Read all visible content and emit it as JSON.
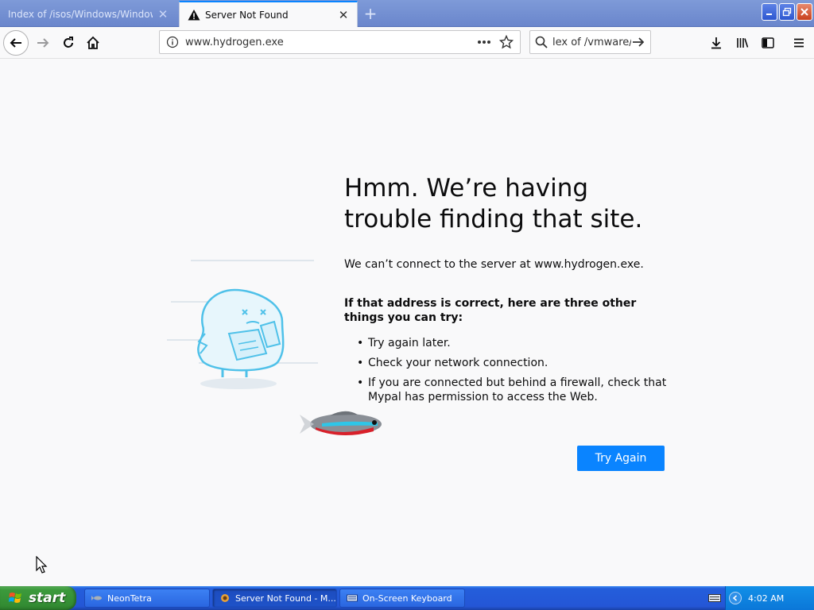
{
  "tabs": [
    {
      "label": "Index of /isos/Windows/Windows_Vist",
      "active": false
    },
    {
      "label": "Server Not Found",
      "active": true
    }
  ],
  "navbar": {
    "url": "www.hydrogen.exe",
    "search_value": "lex of /vmware/"
  },
  "page": {
    "title": "Hmm. We’re having trouble finding that site.",
    "message": "We can’t connect to the server at www.hydrogen.exe.",
    "suggestions_heading": "If that address is correct, here are three other things you can try:",
    "suggestions": [
      "Try again later.",
      "Check your network connection.",
      "If you are connected but behind a firewall, check that Mypal has permission to access the Web."
    ],
    "try_again_label": "Try Again"
  },
  "taskbar": {
    "start_label": "start",
    "tasks": [
      {
        "label": "NeonTetra"
      },
      {
        "label": "Server Not Found - M..."
      },
      {
        "label": "On-Screen Keyboard"
      }
    ],
    "clock": "4:02 AM"
  },
  "colors": {
    "accent": "#0a84ff",
    "tab_active_border": "#0a84ff",
    "taskbar_blue": "#245edb",
    "start_green": "#3c9a3c"
  }
}
